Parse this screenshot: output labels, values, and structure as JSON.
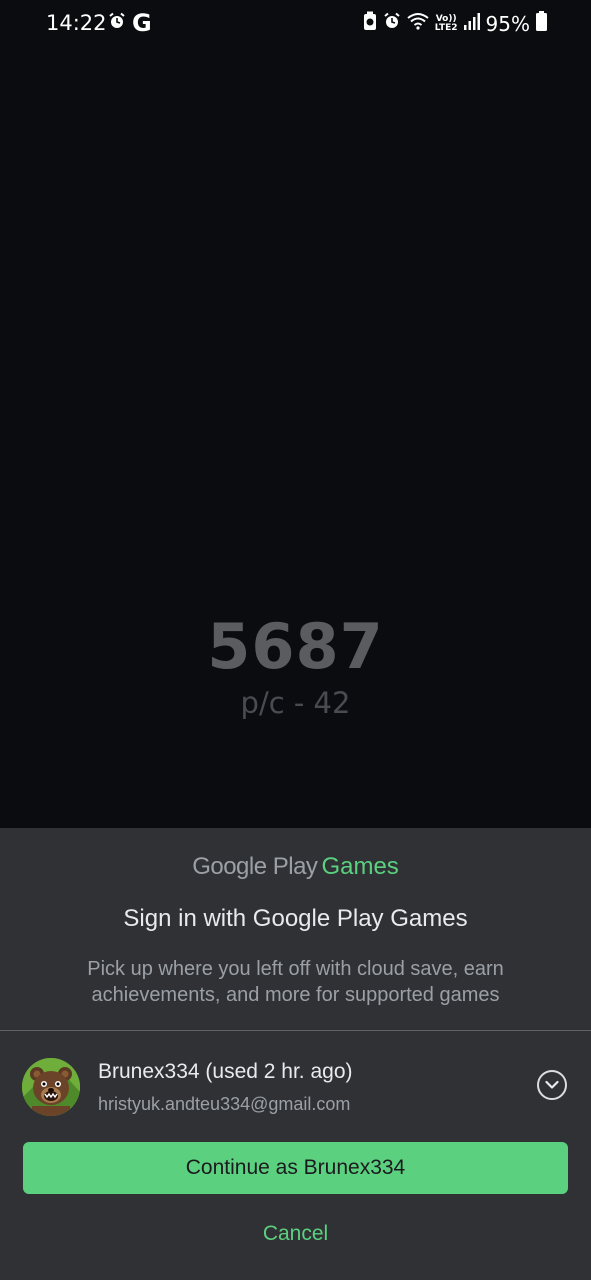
{
  "status_bar": {
    "time": "14:22",
    "google_letter": "G",
    "lte_top": "Vo))",
    "lte_bottom": "LTE2",
    "battery": "95%",
    "icons": [
      "alarm-icon",
      "google-icon",
      "battery-saver-icon",
      "alarm-icon",
      "wifi-icon",
      "signal-icon",
      "battery-icon"
    ]
  },
  "game": {
    "score": "5687",
    "rate": "p/c - 42"
  },
  "sheet": {
    "logo_google_play": "Google Play",
    "logo_games": "Games",
    "title": "Sign in with Google Play Games",
    "description": "Pick up where you left off with cloud save, earn achievements, and more for supported games",
    "account": {
      "name": "Brunex334 (used 2 hr. ago)",
      "email": "hristyuk.andteu334@gmail.com"
    },
    "continue_label": "Continue as Brunex334",
    "cancel_label": "Cancel"
  },
  "colors": {
    "accent": "#5bd07f",
    "sheet_bg": "#303134",
    "screen_bg": "#0b0c10"
  }
}
